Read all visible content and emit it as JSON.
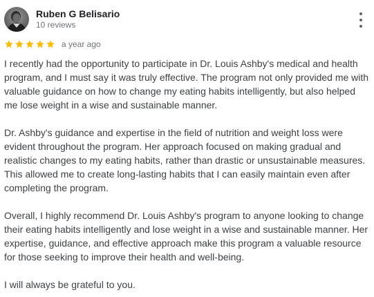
{
  "reviewer": {
    "name": "Ruben G Belisario",
    "review_count": "10 reviews",
    "avatar_icon": "person-photo-avatar"
  },
  "menu": {
    "icon": "more-vert-icon"
  },
  "rating": {
    "stars": 5,
    "max_stars": 5,
    "star_color": "#fbbc04",
    "date": "a year ago"
  },
  "review": {
    "paragraphs": [
      "I recently had the opportunity to participate in Dr. Louis Ashby's medical and health program, and I must say it was truly effective. The program not only provided me with valuable guidance on how to change my eating habits intelligently, but also helped me lose weight in a wise and sustainable manner.",
      "Dr. Ashby's guidance and expertise in the field of nutrition and weight loss were evident throughout the program. Her approach focused on making gradual and realistic changes to my eating habits, rather than drastic or unsustainable measures. This allowed me to create long-lasting habits that I can easily maintain even after completing the program.",
      "Overall, I highly recommend Dr. Louis Ashby's program to anyone looking to change their eating habits intelligently and lose weight in a wise and sustainable manner. Her expertise, guidance, and effective approach make this program a valuable resource for those seeking to improve their health and well-being.",
      "I will always be grateful to you."
    ]
  }
}
